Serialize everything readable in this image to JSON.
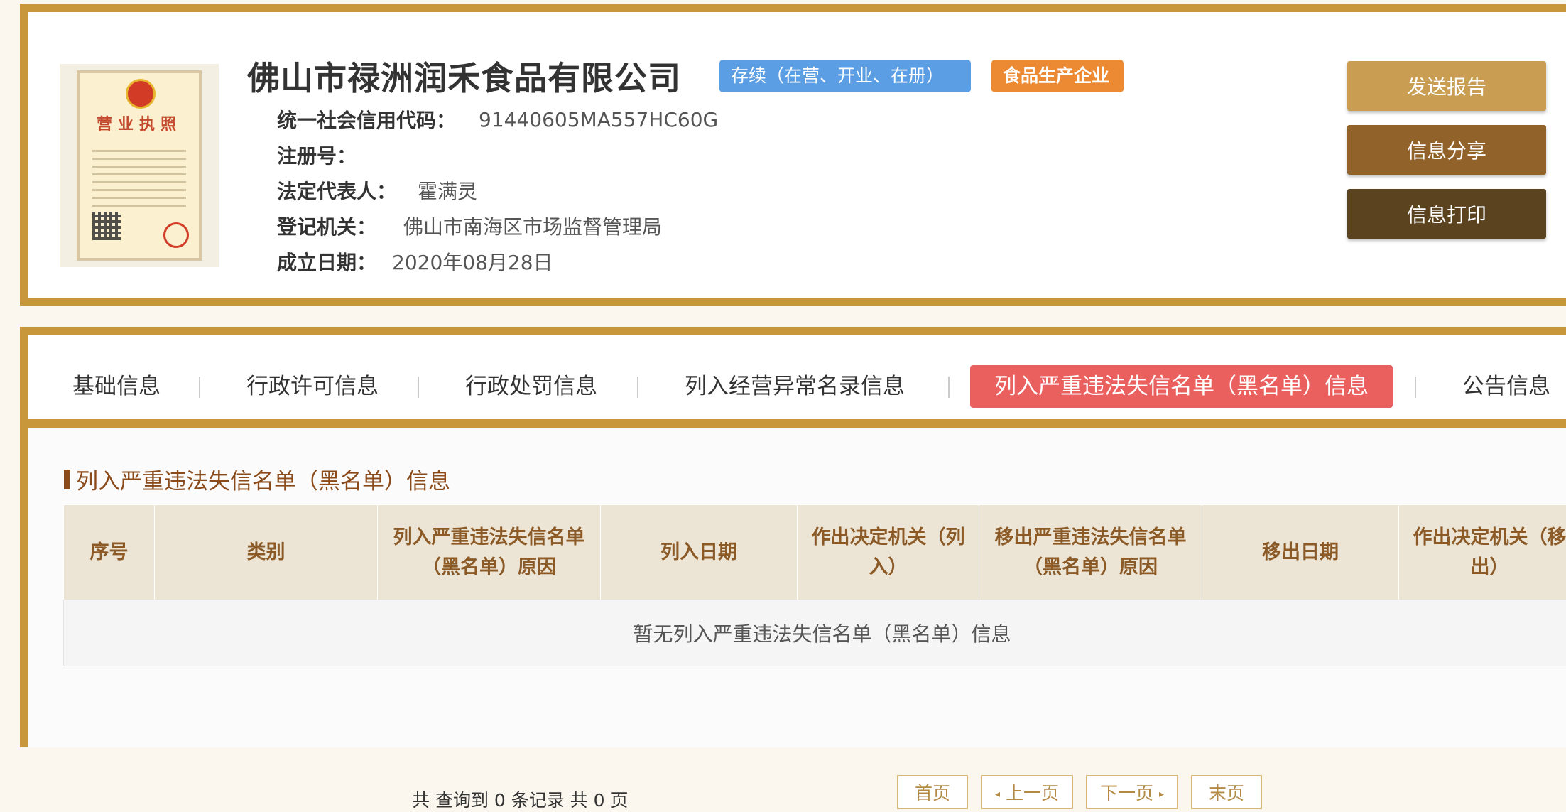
{
  "company": {
    "name": "佛山市禄洲润禾食品有限公司",
    "status_badge": "存续（在营、开业、在册）",
    "type_badge": "食品生产企业",
    "license_title": "营业执照",
    "fields": {
      "credit_code_label": "统一社会信用代码：",
      "credit_code_value": "91440605MA557HC60G",
      "reg_no_label": "注册号：",
      "reg_no_value": "",
      "legal_rep_label": "法定代表人：",
      "legal_rep_value": "霍满灵",
      "authority_label": "登记机关：",
      "authority_value": "佛山市南海区市场监督管理局",
      "founded_label": "成立日期：",
      "founded_value": "2020年08月28日"
    }
  },
  "actions": {
    "send_report": "发送报告",
    "share": "信息分享",
    "print": "信息打印"
  },
  "tabs": [
    {
      "label": "基础信息",
      "active": false
    },
    {
      "label": "行政许可信息",
      "active": false
    },
    {
      "label": "行政处罚信息",
      "active": false
    },
    {
      "label": "列入经营异常名录信息",
      "active": false
    },
    {
      "label": "列入严重违法失信名单（黑名单）信息",
      "active": true
    },
    {
      "label": "公告信息",
      "active": false
    }
  ],
  "section": {
    "title": "列入严重违法失信名单（黑名单）信息",
    "columns": [
      "序号",
      "类别",
      "列入严重违法失信名单（黑名单）原因",
      "列入日期",
      "作出决定机关（列入）",
      "移出严重违法失信名单（黑名单）原因",
      "移出日期",
      "作出决定机关（移出）"
    ],
    "empty_message": "暂无列入严重违法失信名单（黑名单）信息"
  },
  "pagination": {
    "summary": "共 查询到 0 条记录 共 0 页",
    "first": "首页",
    "prev": "上一页",
    "next": "下一页",
    "last": "末页"
  },
  "colors": {
    "border_gold": "#c8973c",
    "status_blue": "#5b9ee3",
    "type_orange": "#ec8a33",
    "active_tab_red": "#e9605e",
    "title_brown": "#8b4a1a"
  }
}
